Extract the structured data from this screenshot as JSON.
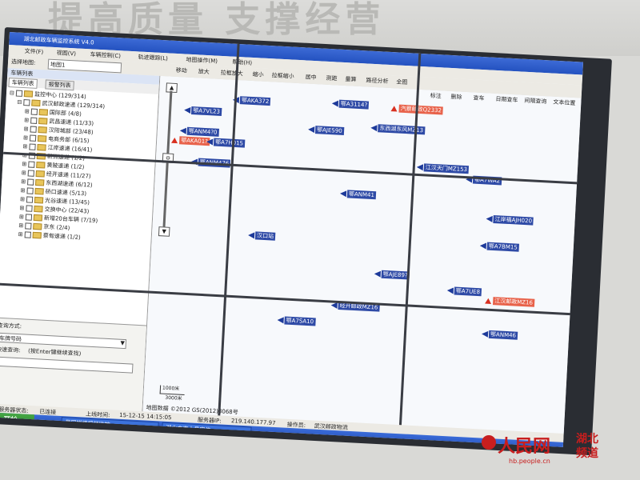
{
  "wall": {
    "slogan": "提高质量 支撑经营"
  },
  "window": {
    "title": "湖北邮政车辆监控系统 V4.0"
  },
  "menu": [
    "文件(F)",
    "视图(V)",
    "车辆控制(C)",
    "轨迹跟踪(L)",
    "地图操作(M)",
    "帮助(H)"
  ],
  "toolbar": {
    "select_map_label": "选择地图:",
    "select_map_value": "地图1",
    "items": [
      "移动",
      "放大",
      "拉框放大",
      "缩小",
      "拉框缩小",
      "居中",
      "测距",
      "量算",
      "路径分析",
      "全图"
    ]
  },
  "map_tools": [
    "标注",
    "删除",
    "查车",
    "日期查车",
    "间隔查询",
    "文本位置"
  ],
  "left_panel": {
    "header": "车辆列表",
    "tabs": [
      "车辆列表",
      "报警列表"
    ],
    "tree": [
      {
        "label": "监控中心 (129/314)",
        "level": 0
      },
      {
        "label": "武汉邮政速递 (129/314)",
        "level": 1
      },
      {
        "label": "国际部 (4/8)",
        "level": 2
      },
      {
        "label": "武昌速递 (11/33)",
        "level": 2
      },
      {
        "label": "汉阳城部 (23/48)",
        "level": 2
      },
      {
        "label": "电商务部 (6/15)",
        "level": 2
      },
      {
        "label": "江岸速递 (16/41)",
        "level": 2
      },
      {
        "label": "新洲速递 (1/2)",
        "level": 2
      },
      {
        "label": "黄陂速递 (1/2)",
        "level": 2
      },
      {
        "label": "经开速递 (11/27)",
        "level": 2
      },
      {
        "label": "东西湖速递 (6/12)",
        "level": 2
      },
      {
        "label": "硚口速递 (5/13)",
        "level": 2
      },
      {
        "label": "光谷速递 (13/45)",
        "level": 2
      },
      {
        "label": "交换中心 (22/43)",
        "level": 2
      },
      {
        "label": "新增20台车辆 (7/19)",
        "level": 2
      },
      {
        "label": "京东 (2/4)",
        "level": 2
      },
      {
        "label": "蔡甸速递 (1/2)",
        "level": 2
      }
    ],
    "query": {
      "mode_label": "查询方式:",
      "mode_value": "车牌号码",
      "quick_label": "快速查询:",
      "quick_hint": "(按Enter键继续查找)"
    }
  },
  "map": {
    "scale_top": "1000米",
    "scale_bottom": "3000米",
    "footer": "地图数据 ©2012 GS(2012)3068号",
    "vehicles": [
      {
        "label": "鄂AKA372",
        "type": "normal"
      },
      {
        "label": "鄂A3114?",
        "type": "normal"
      },
      {
        "label": "汽蔡邮政Q2332",
        "type": "alert"
      },
      {
        "label": "鄂A7VL23",
        "type": "normal"
      },
      {
        "label": "鄂AJE590",
        "type": "normal"
      },
      {
        "label": "东西湖东风MZ13",
        "type": "normal"
      },
      {
        "label": "鄂ANM4?0",
        "type": "normal"
      },
      {
        "label": "鄂AKA01?",
        "type": "alert"
      },
      {
        "label": "鄂A7H015",
        "type": "normal"
      },
      {
        "label": "江汉天门MZ153",
        "type": "normal"
      },
      {
        "label": "鄂ANM476",
        "type": "normal"
      },
      {
        "label": "鄂ANM41",
        "type": "normal"
      },
      {
        "label": "汉口站",
        "type": "normal"
      },
      {
        "label": "鄂A7WA2",
        "type": "normal"
      },
      {
        "label": "江岸福AJH020",
        "type": "normal"
      },
      {
        "label": "鄂AJE89?",
        "type": "normal"
      },
      {
        "label": "鄂A7UE8",
        "type": "normal"
      },
      {
        "label": "江汉邮政MZ16",
        "type": "alert"
      },
      {
        "label": "鄂A7BM15",
        "type": "normal"
      },
      {
        "label": "经开邮政MZ16",
        "type": "normal"
      },
      {
        "label": "鄂A7SA10",
        "type": "normal"
      },
      {
        "label": "鄂ANM46",
        "type": "normal"
      }
    ]
  },
  "status": {
    "server_state_label": "与服务器状态:",
    "server_state": "已连接",
    "login_label": "上线时间:",
    "login_time": "15-12-15 14:15:05",
    "server_label": "服务器IP:",
    "server_ip": "219.140.177.97",
    "operator_label": "操作员:",
    "operator": "武汉邮政物流"
  },
  "taskbar": {
    "start": "开始",
    "tasks": [
      "星网锐捷视频监控",
      "湖北中南人员定位"
    ]
  },
  "watermark": {
    "brand": "人民网",
    "region": "湖北频道",
    "url": "hb.people.cn"
  }
}
